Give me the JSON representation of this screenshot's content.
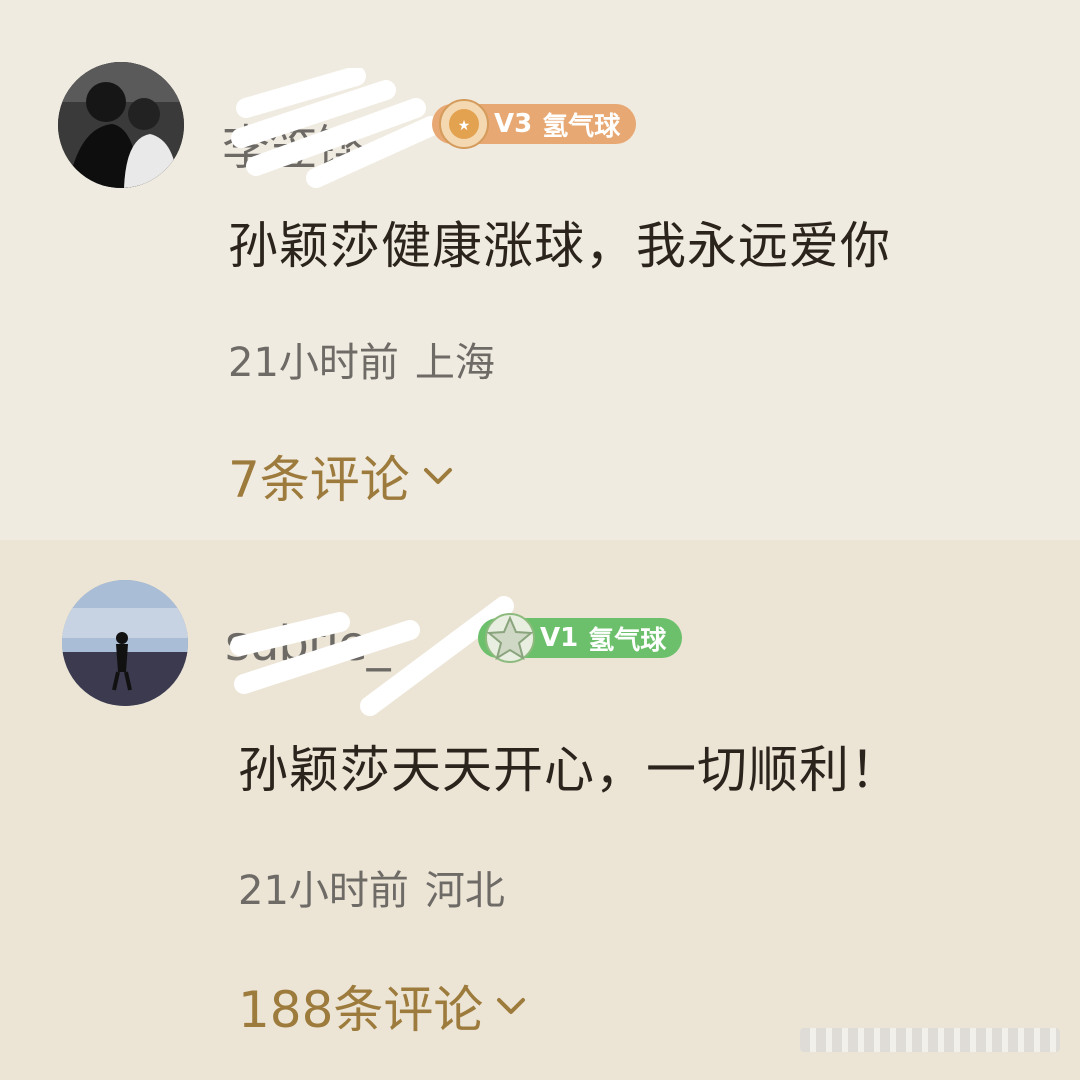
{
  "comments": [
    {
      "username": "李笠铿",
      "badge_level": "V3",
      "badge_text": "氢气球",
      "badge_color": "#e7a873",
      "text": "孙颖莎健康涨球，我永远爱你",
      "time": "21小时前",
      "location": "上海",
      "replies": "7条评论",
      "chevron_icon": "chevron-down-icon"
    },
    {
      "username": "subtle_",
      "badge_level": "V1",
      "badge_text": "氢气球",
      "badge_color": "#6cc06c",
      "text": "孙颖莎天天开心，一切顺利！",
      "time": "21小时前",
      "location": "河北",
      "replies": "188条评论",
      "chevron_icon": "chevron-down-icon"
    }
  ],
  "colors": {
    "background": "#f0ebe0",
    "reply_link": "#9d7b3c",
    "meta_text": "#6e6a66"
  }
}
